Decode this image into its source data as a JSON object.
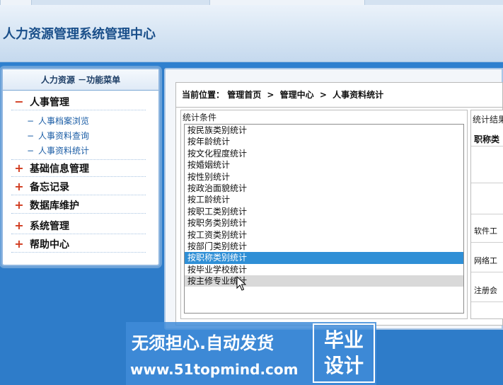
{
  "header": {
    "title": "人力资源管理系统管理中心"
  },
  "menu": {
    "title": "人力资源 －功能菜单",
    "groups": [
      {
        "sign": "−",
        "label": "人事管理",
        "expanded": true
      },
      {
        "sign": "+",
        "label": "基础信息管理"
      },
      {
        "sign": "+",
        "label": "备忘记录"
      },
      {
        "sign": "+",
        "label": "数据库维护"
      },
      {
        "sign": "+",
        "label": "系统管理"
      },
      {
        "sign": "+",
        "label": "帮助中心"
      }
    ],
    "sub_items": [
      {
        "dash": "−",
        "label": "人事档案浏览"
      },
      {
        "dash": "−",
        "label": "人事资料查询"
      },
      {
        "dash": "−",
        "label": "人事资料统计"
      }
    ]
  },
  "breadcrumb": {
    "prefix": "当前位置：",
    "items": [
      "管理首页",
      "管理中心",
      "人事资料统计"
    ],
    "separator": ">"
  },
  "conditions": {
    "title": "统计条件",
    "items": [
      "按民族类别统计",
      "按年龄统计",
      "按文化程度统计",
      "按婚姻统计",
      "按性别统计",
      "按政治面貌统计",
      "按工龄统计",
      "按职工类别统计",
      "按职务类别统计",
      "按工资类别统计",
      "按部门类别统计",
      "按职称类别统计",
      "按毕业学校统计",
      "按主修专业统计"
    ],
    "selected_index": 11,
    "hover_index": 13
  },
  "result": {
    "title": "统计结果",
    "header": "职称类",
    "rows": [
      "软件工",
      "网络工",
      "注册会"
    ]
  },
  "watermark": {
    "slogan": "无须担心.自动发货",
    "url": "www.51topmind.com",
    "badge_line1": "毕业",
    "badge_line2": "设计"
  },
  "colors": {
    "accent": "#2e7cc9",
    "selected_row": "#2f8fd6",
    "menu_sign": "#d13a1e",
    "link": "#1c5ea6"
  }
}
